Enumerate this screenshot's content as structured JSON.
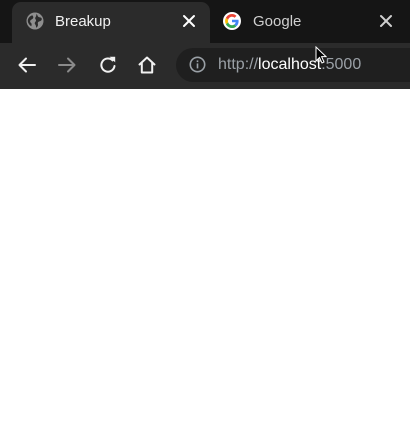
{
  "tabs": [
    {
      "title": "Breakup",
      "favicon": "globe-icon",
      "active": true
    },
    {
      "title": "Google",
      "favicon": "google-icon",
      "active": false
    }
  ],
  "toolbar": {
    "back": "arrow-left-icon",
    "forward": "arrow-right-icon",
    "reload": "reload-icon",
    "home": "home-icon"
  },
  "omnibox": {
    "url_scheme": "http://",
    "url_host": "localhost",
    "url_port": ":5000"
  },
  "colors": {
    "tab_strip": "#151515",
    "toolbar": "#2b2b2b",
    "omnibox": "#1f1f1f",
    "page": "#ffffff"
  }
}
